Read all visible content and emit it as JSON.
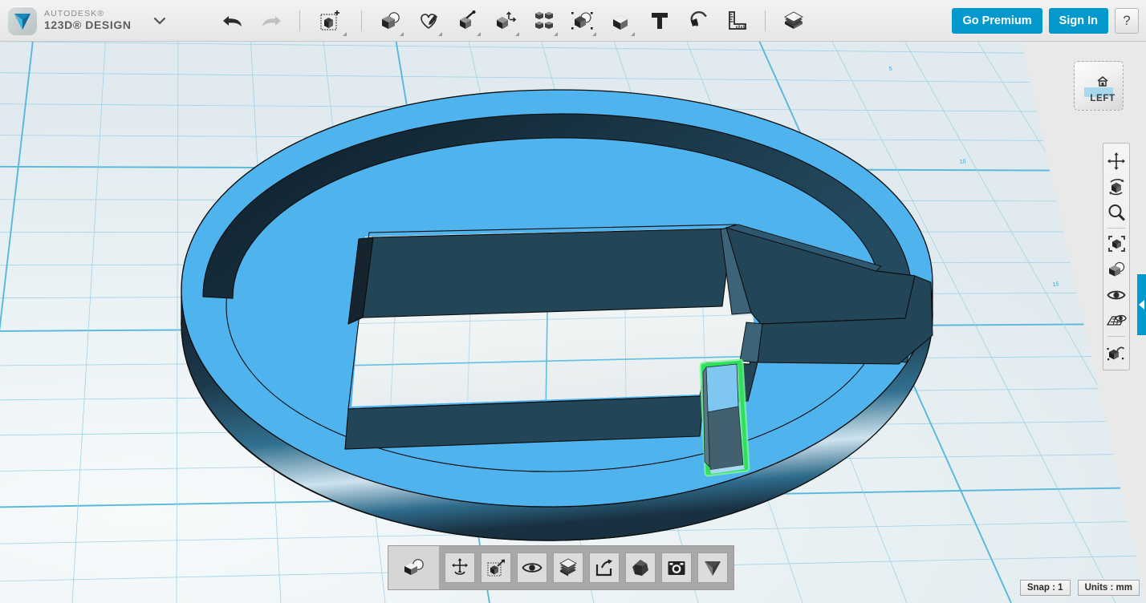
{
  "app": {
    "brand_top": "AUTODESK®",
    "brand_bottom": "123D® DESIGN",
    "logo_icon": "autodesk-123d-logo-icon",
    "menu_caret_icon": "chevron-down-icon"
  },
  "header": {
    "history": [
      {
        "name": "undo-button",
        "icon": "undo-arrow-icon",
        "label": "Undo",
        "enabled": true
      },
      {
        "name": "redo-button",
        "icon": "redo-arrow-icon",
        "label": "Redo",
        "enabled": false
      }
    ],
    "transform": {
      "name": "transform-button",
      "icon": "transform-move-cube-icon",
      "label": "Transform",
      "has_dropdown": true
    },
    "tools": [
      {
        "name": "primitives-button",
        "icon": "primitives-cube-sphere-icon",
        "label": "Primitives",
        "has_dropdown": true
      },
      {
        "name": "sketch-button",
        "icon": "sketch-pen-shape-icon",
        "label": "Sketch",
        "has_dropdown": true
      },
      {
        "name": "construct-button",
        "icon": "construct-extrude-icon",
        "label": "Construct",
        "has_dropdown": true
      },
      {
        "name": "modify-button",
        "icon": "modify-cube-arrows-icon",
        "label": "Modify",
        "has_dropdown": true
      },
      {
        "name": "pattern-button",
        "icon": "pattern-four-cubes-icon",
        "label": "Pattern",
        "has_dropdown": true
      },
      {
        "name": "grouping-button",
        "icon": "grouping-selection-icon",
        "label": "Grouping",
        "has_dropdown": true
      },
      {
        "name": "combine-button",
        "icon": "combine-cube-icon",
        "label": "Combine",
        "has_dropdown": true
      },
      {
        "name": "text-button",
        "icon": "text-letter-t-icon",
        "label": "Text",
        "has_dropdown": false
      },
      {
        "name": "snap-button",
        "icon": "snap-magnet-icon",
        "label": "Snap",
        "has_dropdown": false
      },
      {
        "name": "measure-button",
        "icon": "measure-ruler-icon",
        "label": "Measure",
        "has_dropdown": false
      }
    ],
    "materials": {
      "name": "materials-button",
      "icon": "materials-layers-cube-icon",
      "label": "Material"
    },
    "go_premium_label": "Go Premium",
    "sign_in_label": "Sign In",
    "help_label": "?",
    "accent_color": "#0399cc"
  },
  "viewcube": {
    "face_label": "LEFT",
    "home_icon": "home-house-icon",
    "highlight_color": "#a8d8ee"
  },
  "navbar": {
    "items": [
      {
        "name": "nav-pan",
        "icon": "pan-four-arrows-icon",
        "label": "Pan"
      },
      {
        "name": "nav-orbit",
        "icon": "orbit-cube-rotate-icon",
        "label": "Orbit"
      },
      {
        "name": "nav-zoom",
        "icon": "zoom-magnifier-icon",
        "label": "Zoom"
      },
      {
        "name": "nav-fit",
        "icon": "fit-to-window-cube-icon",
        "label": "Fit"
      },
      {
        "name": "nav-shading",
        "icon": "shading-cube-sphere-icon",
        "label": "Shading"
      },
      {
        "name": "nav-visibility",
        "icon": "eye-visibility-icon",
        "label": "Visibility"
      },
      {
        "name": "nav-grid",
        "icon": "grid-eye-icon",
        "label": "Grid / Snap Display"
      },
      {
        "name": "nav-snap",
        "icon": "snap-cube-magnet-icon",
        "label": "Snap Settings"
      }
    ]
  },
  "panel_tab": {
    "name": "right-panel-tab",
    "icon": "chevron-left-icon",
    "color": "#039ad0"
  },
  "bottombar": {
    "left": {
      "name": "bottom-combine-button",
      "icon": "combine-cube-sphere-icon",
      "label": "Combine"
    },
    "items": [
      {
        "name": "bottom-transform",
        "icon": "transform-anchor-arrows-icon",
        "label": "Transform"
      },
      {
        "name": "bottom-move",
        "icon": "move-cube-arrow-icon",
        "label": "Move/Rotate"
      },
      {
        "name": "bottom-visible",
        "icon": "eye-visibility-icon",
        "label": "Show/Hide"
      },
      {
        "name": "bottom-layers",
        "icon": "layers-stack-icon",
        "label": "Layers"
      },
      {
        "name": "bottom-export",
        "icon": "export-share-arrow-icon",
        "label": "Export"
      },
      {
        "name": "bottom-material",
        "icon": "material-sphere-icon",
        "label": "Material"
      },
      {
        "name": "bottom-snapshot",
        "icon": "camera-snapshot-icon",
        "label": "Snapshot"
      },
      {
        "name": "bottom-logo",
        "icon": "123d-triangle-logo-icon",
        "label": "123D"
      }
    ]
  },
  "status": {
    "snap_label": "Snap : 1",
    "units_label": "Units : mm"
  },
  "viewport": {
    "background_color": "#e9e9e9",
    "grid_plane_color": "#e4edf0",
    "grid_line_color": "#9ed2e6",
    "grid_major_color": "#57b8db",
    "grid_numbers": [
      "5",
      "10",
      "15"
    ],
    "model": {
      "name": "extruded-c-shape-disc",
      "top_color": "#4fb3ee",
      "wall_color": "#234558",
      "wall_dark_color": "#16242f",
      "rim_color": "#2d6384",
      "edge_color": "#101010",
      "floor_color": "#f2f5f5"
    },
    "selection": {
      "name": "selected-box-solid",
      "outline_color": "#2ee05a",
      "glow_color": "#7af59a",
      "top_color": "#7fc7f0",
      "front_color": "#43606e",
      "side_color": "#5d7783"
    }
  }
}
